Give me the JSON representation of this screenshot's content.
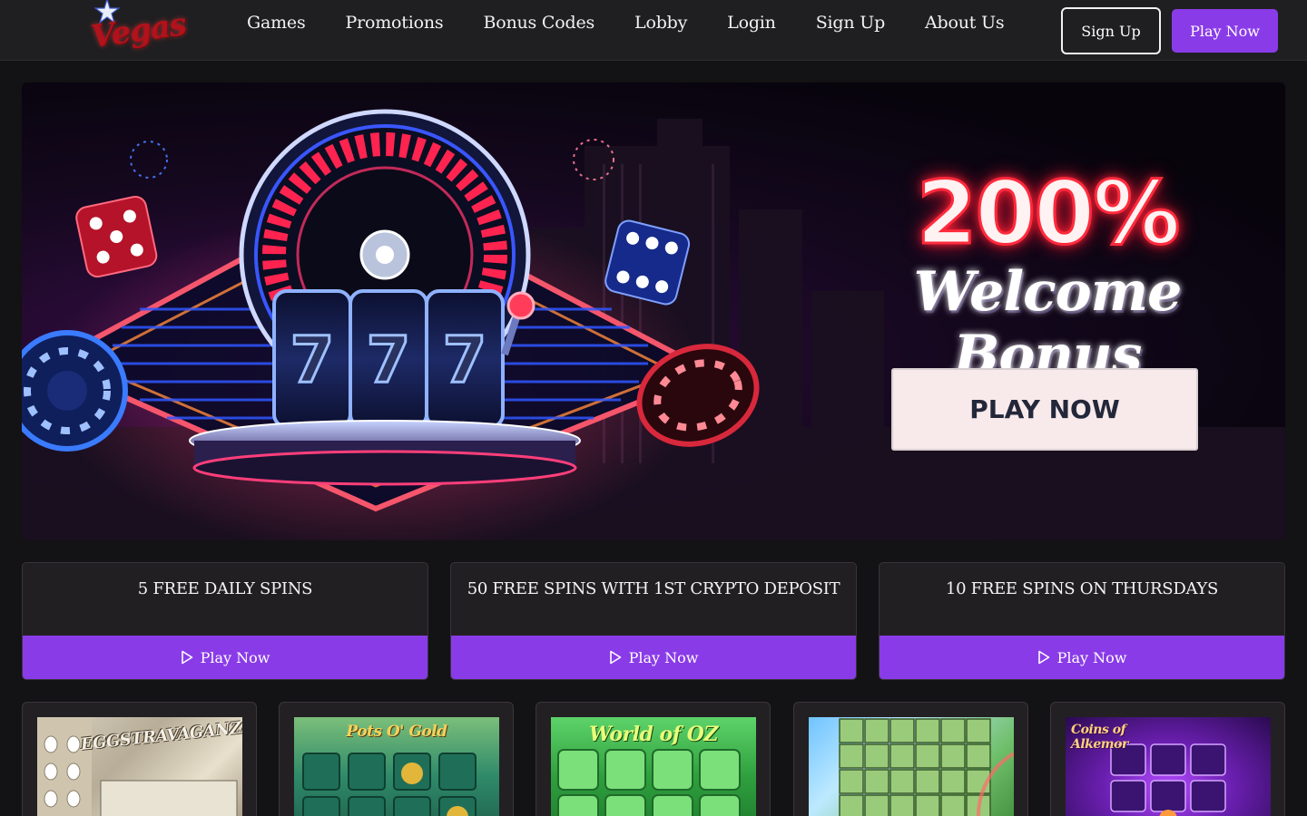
{
  "header": {
    "logo_text": "Vegas",
    "nav": [
      "Games",
      "Promotions",
      "Bonus Codes",
      "Lobby",
      "Login",
      "Sign Up",
      "About Us"
    ],
    "signup_label": "Sign Up",
    "playnow_label": "Play Now"
  },
  "hero": {
    "headline": "200%",
    "subheadline": "Welcome Bonus",
    "cta_label": "PLAY NOW",
    "reel_symbols": [
      "7",
      "7",
      "7"
    ],
    "roulette_numbers": [
      "18",
      "29",
      "7",
      "28",
      "12",
      "35",
      "3",
      "26",
      "0",
      "32",
      "15",
      "19",
      "4",
      "21",
      "2",
      "9",
      "22",
      "31",
      "14",
      "20",
      "1",
      "33",
      "16"
    ]
  },
  "promos": [
    {
      "title": "5 FREE DAILY SPINS",
      "button": "Play Now"
    },
    {
      "title": "50 FREE SPINS WITH 1ST CRYPTO DEPOSIT",
      "button": "Play Now"
    },
    {
      "title": "10 FREE SPINS ON THURSDAYS",
      "button": "Play Now"
    }
  ],
  "games": [
    {
      "title": "EGGSTRAVAGANZA"
    },
    {
      "title": "Pots O' Gold"
    },
    {
      "title": "World of OZ"
    },
    {
      "title": ""
    },
    {
      "title": "Coins of Alkemor"
    }
  ],
  "colors": {
    "accent": "#8a3be8",
    "header_bg": "#1f1f21",
    "page_bg": "#131214",
    "neon_red": "#ff2a3c",
    "neon_blue": "#2a6bff"
  }
}
